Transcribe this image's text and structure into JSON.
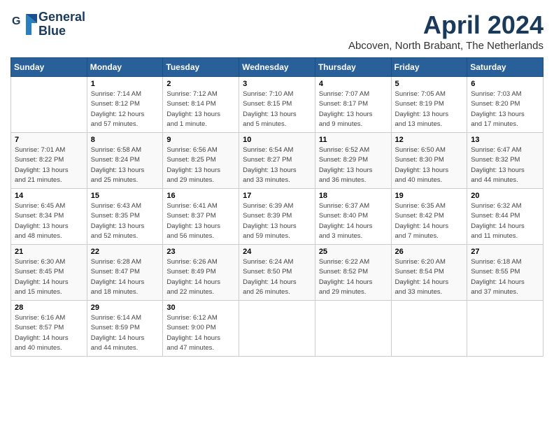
{
  "header": {
    "logo_line1": "General",
    "logo_line2": "Blue",
    "month": "April 2024",
    "location": "Abcoven, North Brabant, The Netherlands"
  },
  "weekdays": [
    "Sunday",
    "Monday",
    "Tuesday",
    "Wednesday",
    "Thursday",
    "Friday",
    "Saturday"
  ],
  "weeks": [
    [
      {
        "day": "",
        "info": ""
      },
      {
        "day": "1",
        "info": "Sunrise: 7:14 AM\nSunset: 8:12 PM\nDaylight: 12 hours\nand 57 minutes."
      },
      {
        "day": "2",
        "info": "Sunrise: 7:12 AM\nSunset: 8:14 PM\nDaylight: 13 hours\nand 1 minute."
      },
      {
        "day": "3",
        "info": "Sunrise: 7:10 AM\nSunset: 8:15 PM\nDaylight: 13 hours\nand 5 minutes."
      },
      {
        "day": "4",
        "info": "Sunrise: 7:07 AM\nSunset: 8:17 PM\nDaylight: 13 hours\nand 9 minutes."
      },
      {
        "day": "5",
        "info": "Sunrise: 7:05 AM\nSunset: 8:19 PM\nDaylight: 13 hours\nand 13 minutes."
      },
      {
        "day": "6",
        "info": "Sunrise: 7:03 AM\nSunset: 8:20 PM\nDaylight: 13 hours\nand 17 minutes."
      }
    ],
    [
      {
        "day": "7",
        "info": "Sunrise: 7:01 AM\nSunset: 8:22 PM\nDaylight: 13 hours\nand 21 minutes."
      },
      {
        "day": "8",
        "info": "Sunrise: 6:58 AM\nSunset: 8:24 PM\nDaylight: 13 hours\nand 25 minutes."
      },
      {
        "day": "9",
        "info": "Sunrise: 6:56 AM\nSunset: 8:25 PM\nDaylight: 13 hours\nand 29 minutes."
      },
      {
        "day": "10",
        "info": "Sunrise: 6:54 AM\nSunset: 8:27 PM\nDaylight: 13 hours\nand 33 minutes."
      },
      {
        "day": "11",
        "info": "Sunrise: 6:52 AM\nSunset: 8:29 PM\nDaylight: 13 hours\nand 36 minutes."
      },
      {
        "day": "12",
        "info": "Sunrise: 6:50 AM\nSunset: 8:30 PM\nDaylight: 13 hours\nand 40 minutes."
      },
      {
        "day": "13",
        "info": "Sunrise: 6:47 AM\nSunset: 8:32 PM\nDaylight: 13 hours\nand 44 minutes."
      }
    ],
    [
      {
        "day": "14",
        "info": "Sunrise: 6:45 AM\nSunset: 8:34 PM\nDaylight: 13 hours\nand 48 minutes."
      },
      {
        "day": "15",
        "info": "Sunrise: 6:43 AM\nSunset: 8:35 PM\nDaylight: 13 hours\nand 52 minutes."
      },
      {
        "day": "16",
        "info": "Sunrise: 6:41 AM\nSunset: 8:37 PM\nDaylight: 13 hours\nand 56 minutes."
      },
      {
        "day": "17",
        "info": "Sunrise: 6:39 AM\nSunset: 8:39 PM\nDaylight: 13 hours\nand 59 minutes."
      },
      {
        "day": "18",
        "info": "Sunrise: 6:37 AM\nSunset: 8:40 PM\nDaylight: 14 hours\nand 3 minutes."
      },
      {
        "day": "19",
        "info": "Sunrise: 6:35 AM\nSunset: 8:42 PM\nDaylight: 14 hours\nand 7 minutes."
      },
      {
        "day": "20",
        "info": "Sunrise: 6:32 AM\nSunset: 8:44 PM\nDaylight: 14 hours\nand 11 minutes."
      }
    ],
    [
      {
        "day": "21",
        "info": "Sunrise: 6:30 AM\nSunset: 8:45 PM\nDaylight: 14 hours\nand 15 minutes."
      },
      {
        "day": "22",
        "info": "Sunrise: 6:28 AM\nSunset: 8:47 PM\nDaylight: 14 hours\nand 18 minutes."
      },
      {
        "day": "23",
        "info": "Sunrise: 6:26 AM\nSunset: 8:49 PM\nDaylight: 14 hours\nand 22 minutes."
      },
      {
        "day": "24",
        "info": "Sunrise: 6:24 AM\nSunset: 8:50 PM\nDaylight: 14 hours\nand 26 minutes."
      },
      {
        "day": "25",
        "info": "Sunrise: 6:22 AM\nSunset: 8:52 PM\nDaylight: 14 hours\nand 29 minutes."
      },
      {
        "day": "26",
        "info": "Sunrise: 6:20 AM\nSunset: 8:54 PM\nDaylight: 14 hours\nand 33 minutes."
      },
      {
        "day": "27",
        "info": "Sunrise: 6:18 AM\nSunset: 8:55 PM\nDaylight: 14 hours\nand 37 minutes."
      }
    ],
    [
      {
        "day": "28",
        "info": "Sunrise: 6:16 AM\nSunset: 8:57 PM\nDaylight: 14 hours\nand 40 minutes."
      },
      {
        "day": "29",
        "info": "Sunrise: 6:14 AM\nSunset: 8:59 PM\nDaylight: 14 hours\nand 44 minutes."
      },
      {
        "day": "30",
        "info": "Sunrise: 6:12 AM\nSunset: 9:00 PM\nDaylight: 14 hours\nand 47 minutes."
      },
      {
        "day": "",
        "info": ""
      },
      {
        "day": "",
        "info": ""
      },
      {
        "day": "",
        "info": ""
      },
      {
        "day": "",
        "info": ""
      }
    ]
  ]
}
